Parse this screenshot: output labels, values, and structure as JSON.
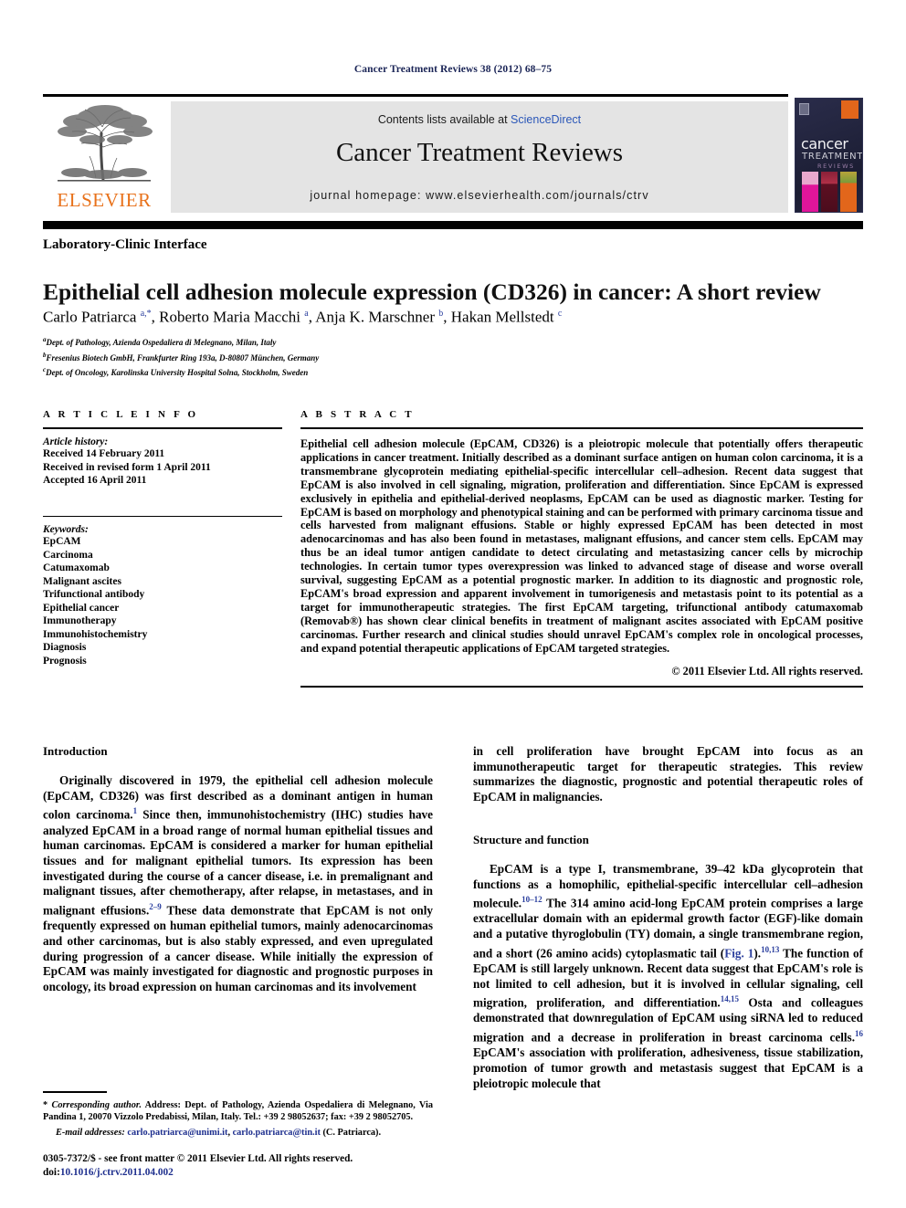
{
  "running_head": "Cancer Treatment Reviews 38 (2012) 68–75",
  "masthead": {
    "contents_prefix": "Contents lists available at ",
    "contents_link": "ScienceDirect",
    "journal_title": "Cancer Treatment Reviews",
    "homepage": "journal homepage: www.elsevierhealth.com/journals/ctrv",
    "publisher": "ELSEVIER",
    "cover": {
      "line1": "cancer",
      "line2": "TREATMENT",
      "line3": "REVIEWS"
    }
  },
  "article": {
    "section_label": "Laboratory-Clinic Interface",
    "title": "Epithelial cell adhesion molecule expression (CD326) in cancer: A short review",
    "authors_html": "Carlo Patriarca <sup>a,*</sup>, Roberto Maria Macchi <sup>a</sup>, Anja K. Marschner <sup>b</sup>, Hakan Mellstedt <sup>c</sup>",
    "affiliations": [
      "Dept. of Pathology, Azienda Ospedaliera di Melegnano, Milan, Italy",
      "Fresenius Biotech GmbH, Frankfurter Ring 193a, D-80807 München, Germany",
      "Dept. of Oncology, Karolinska University Hospital Solna, Stockholm, Sweden"
    ],
    "affiliation_marks": [
      "a",
      "b",
      "c"
    ]
  },
  "article_info": {
    "heading": "A R T I C L E    I N F O",
    "history_label": "Article history:",
    "history": [
      "Received 14 February 2011",
      "Received in revised form 1 April 2011",
      "Accepted 16 April 2011"
    ],
    "keywords_label": "Keywords:",
    "keywords": [
      "EpCAM",
      "Carcinoma",
      "Catumaxomab",
      "Malignant ascites",
      "Trifunctional antibody",
      "Epithelial cancer",
      "Immunotherapy",
      "Immunohistochemistry",
      "Diagnosis",
      "Prognosis"
    ]
  },
  "abstract": {
    "heading": "A B S T R A C T",
    "text": "Epithelial cell adhesion molecule (EpCAM, CD326) is a pleiotropic molecule that potentially offers therapeutic applications in cancer treatment. Initially described as a dominant surface antigen on human colon carcinoma, it is a transmembrane glycoprotein mediating epithelial-specific intercellular cell–adhesion. Recent data suggest that EpCAM is also involved in cell signaling, migration, proliferation and differentiation. Since EpCAM is expressed exclusively in epithelia and epithelial-derived neoplasms, EpCAM can be used as diagnostic marker. Testing for EpCAM is based on morphology and phenotypical staining and can be performed with primary carcinoma tissue and cells harvested from malignant effusions. Stable or highly expressed EpCAM has been detected in most adenocarcinomas and has also been found in metastases, malignant effusions, and cancer stem cells. EpCAM may thus be an ideal tumor antigen candidate to detect circulating and metastasizing cancer cells by microchip technologies. In certain tumor types overexpression was linked to advanced stage of disease and worse overall survival, suggesting EpCAM as a potential prognostic marker. In addition to its diagnostic and prognostic role, EpCAM's broad expression and apparent involvement in tumorigenesis and metastasis point to its potential as a target for immunotherapeutic strategies. The first EpCAM targeting, trifunctional antibody catumaxomab (Removab®) has shown clear clinical benefits in treatment of malignant ascites associated with EpCAM positive carcinomas. Further research and clinical studies should unravel EpCAM's complex role in oncological processes, and expand potential therapeutic applications of EpCAM targeted strategies.",
    "copyright": "© 2011 Elsevier Ltd. All rights reserved."
  },
  "body": {
    "left": {
      "heading": "Introduction",
      "paragraph_1_html": "Originally discovered in 1979, the epithelial cell adhesion molecule (EpCAM, CD326) was first described as a dominant antigen in human colon carcinoma.<sup>1</sup> Since then, immunohistochemistry (IHC) studies have analyzed EpCAM in a broad range of normal human epithelial tissues and human carcinomas. EpCAM is considered a marker for human epithelial tissues and for malignant epithelial tumors. Its expression has been investigated during the course of a cancer disease, i.e. in premalignant and malignant tissues, after chemotherapy, after relapse, in metastases, and in malignant effusions.<sup>2–9</sup> These data demonstrate that EpCAM is not only frequently expressed on human epithelial tumors, mainly adenocarcinomas and other carcinomas, but is also stably expressed, and even upregulated during progression of a cancer disease. While initially the expression of EpCAM was mainly investigated for diagnostic and prognostic purposes in oncology, its broad expression on human carcinomas and its involvement"
    },
    "right": {
      "paragraph_continue_html": "in cell proliferation have brought EpCAM into focus as an immunotherapeutic target for therapeutic strategies. This review summarizes the diagnostic, prognostic and potential therapeutic roles of EpCAM in malignancies.",
      "heading": "Structure and function",
      "paragraph_1_html": "EpCAM is a type I, transmembrane, 39–42 kDa glycoprotein that functions as a homophilic, epithelial-specific intercellular cell–adhesion molecule.<sup>10–12</sup> The 314 amino acid-long EpCAM protein comprises a large extracellular domain with an epidermal growth factor (EGF)-like domain and a putative thyroglobulin (TY) domain, a single transmembrane region, and a short (26 amino acids) cytoplasmatic tail (<span class=\"blue\">Fig. 1</span>).<sup>10,13</sup> The function of EpCAM is still largely unknown. Recent data suggest that EpCAM's role is not limited to cell adhesion, but it is involved in cellular signaling, cell migration, proliferation, and differentiation.<sup>14,15</sup> Osta and colleagues demonstrated that downregulation of EpCAM using siRNA led to reduced migration and a decrease in proliferation in breast carcinoma cells.<sup>16</sup> EpCAM's association with proliferation, adhesiveness, tissue stabilization, promotion of tumor growth and metastasis suggest that EpCAM is a pleiotropic molecule that"
    }
  },
  "footnote": {
    "corresponding_html": "* <span class=\"ital\">Corresponding author.</span> Address: Dept. of Pathology, Azienda Ospedaliera di Melegnano, Via Pandina 1, 20070 Vizzolo Predabissi, Milan, Italy. Tel.: +39 2 98052637; fax: +39 2 98052705.",
    "email_html": "<span class=\"ital\">E-mail addresses:</span> <span class=\"fn-link\">carlo.patriarca@unimi.it</span>, <span class=\"fn-link\">carlo.patriarca@tin.it</span> (C. Patriarca)."
  },
  "imprint": {
    "line1": "0305-7372/$ - see front matter © 2011 Elsevier Ltd. All rights reserved.",
    "doi_label": "doi:",
    "doi_value": "10.1016/j.ctrv.2011.04.002"
  },
  "colors": {
    "running_head": "#1a2456",
    "elsevier_orange": "#e8711a",
    "link_blue": "#2b57b8",
    "ref_blue": "#2b3f9e",
    "panel_gray": "#e4e4e4"
  }
}
